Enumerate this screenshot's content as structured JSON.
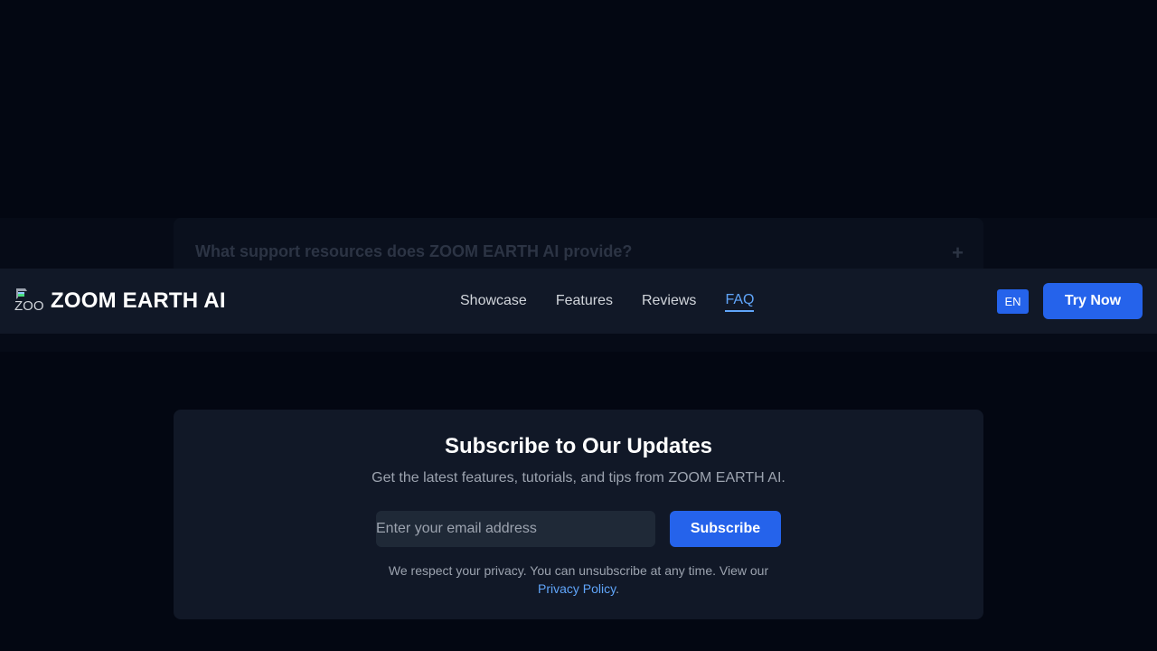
{
  "faq": {
    "question": "What support resources does ZOOM EARTH AI provide?",
    "toggle_symbol": "+"
  },
  "navbar": {
    "logo_alt": "ZOOM EARTH AI",
    "brand": "ZOOM EARTH AI",
    "links": [
      {
        "label": "Showcase",
        "active": false
      },
      {
        "label": "Features",
        "active": false
      },
      {
        "label": "Reviews",
        "active": false
      },
      {
        "label": "FAQ",
        "active": true
      }
    ],
    "language": "EN",
    "cta": "Try Now"
  },
  "subscribe": {
    "title": "Subscribe to Our Updates",
    "description": "Get the latest features, tutorials, and tips from ZOOM EARTH AI.",
    "email_placeholder": "Enter your email address",
    "button": "Subscribe",
    "privacy_text": "We respect your privacy. You can unsubscribe at any time. View our",
    "privacy_link": "Privacy Policy",
    "privacy_end": "."
  },
  "colors": {
    "background": "#030712",
    "card": "#111827",
    "accent": "#2563eb",
    "link": "#60a5fa"
  }
}
